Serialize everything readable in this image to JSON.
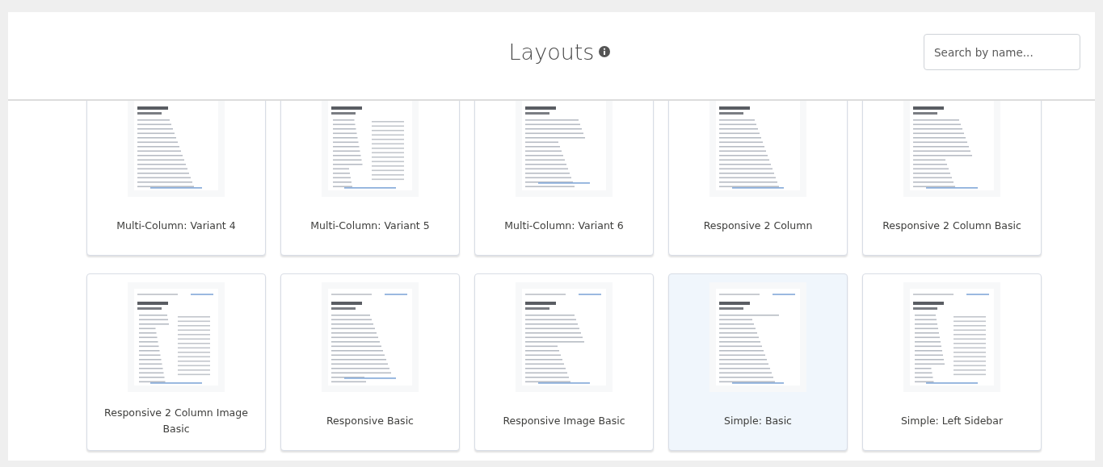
{
  "header": {
    "title": "Layouts",
    "search": {
      "placeholder": "Search by name..."
    }
  },
  "layouts": [
    {
      "name": "Multi-Column: Variant 4",
      "selected": false
    },
    {
      "name": "Multi-Column: Variant 5",
      "selected": false
    },
    {
      "name": "Multi-Column: Variant 6",
      "selected": false
    },
    {
      "name": "Responsive 2 Column",
      "selected": false
    },
    {
      "name": "Responsive 2 Column Basic",
      "selected": false
    },
    {
      "name": "Responsive 2 Column Image Basic",
      "selected": false
    },
    {
      "name": "Responsive Basic",
      "selected": false
    },
    {
      "name": "Responsive Image Basic",
      "selected": false
    },
    {
      "name": "Simple: Basic",
      "selected": true
    },
    {
      "name": "Simple: Left Sidebar",
      "selected": false
    }
  ]
}
